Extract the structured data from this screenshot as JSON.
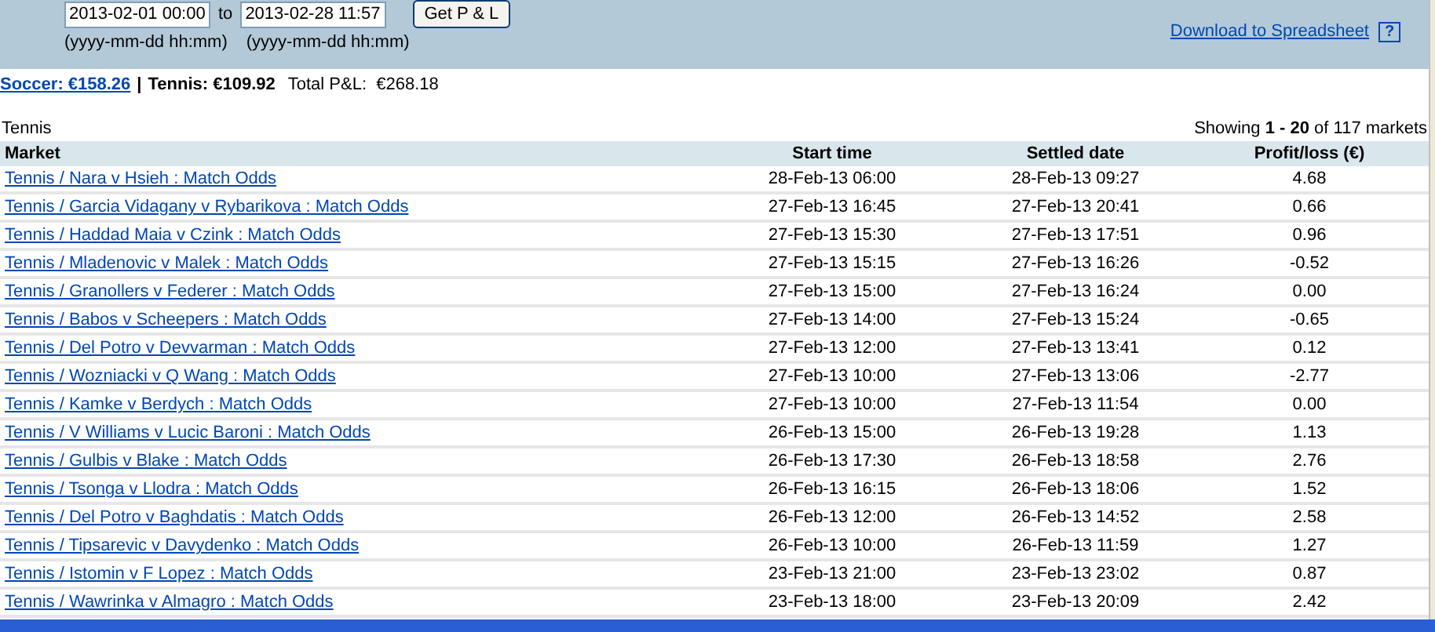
{
  "filter": {
    "from_value": "2013-02-01 00:00",
    "to_label": "to",
    "to_value": "2013-02-28 11:57",
    "button": "Get P & L",
    "from_hint": "(yyyy-mm-dd hh:mm)",
    "to_hint": "(yyyy-mm-dd hh:mm)",
    "download_link": "Download to Spreadsheet",
    "help": "?"
  },
  "summary": {
    "soccer": "Soccer: €158.26",
    "separator": "|",
    "tennis": "Tennis: €109.92",
    "total": "Total P&L:  €268.18"
  },
  "section": "Tennis",
  "showing": "Showing **1 - 20** of 117 markets",
  "table": {
    "columns": [
      "Market",
      "Start time",
      "Settled date",
      "Profit/loss (€)"
    ],
    "rows": [
      [
        "Tennis / Nara v Hsieh : Match Odds",
        "28-Feb-13 06:00",
        "28-Feb-13 09:27",
        "4.68"
      ],
      [
        "Tennis / Garcia Vidagany v Rybarikova : Match Odds",
        "27-Feb-13 16:45",
        "27-Feb-13 20:41",
        "0.66"
      ],
      [
        "Tennis / Haddad Maia v Czink : Match Odds",
        "27-Feb-13 15:30",
        "27-Feb-13 17:51",
        "0.96"
      ],
      [
        "Tennis / Mladenovic v Malek : Match Odds",
        "27-Feb-13 15:15",
        "27-Feb-13 16:26",
        "-0.52"
      ],
      [
        "Tennis / Granollers v Federer : Match Odds",
        "27-Feb-13 15:00",
        "27-Feb-13 16:24",
        "0.00"
      ],
      [
        "Tennis / Babos v Scheepers : Match Odds",
        "27-Feb-13 14:00",
        "27-Feb-13 15:24",
        "-0.65"
      ],
      [
        "Tennis / Del Potro v Devvarman : Match Odds",
        "27-Feb-13 12:00",
        "27-Feb-13 13:41",
        "0.12"
      ],
      [
        "Tennis / Wozniacki v Q Wang : Match Odds",
        "27-Feb-13 10:00",
        "27-Feb-13 13:06",
        "-2.77"
      ],
      [
        "Tennis / Kamke v Berdych : Match Odds",
        "27-Feb-13 10:00",
        "27-Feb-13 11:54",
        "0.00"
      ],
      [
        "Tennis / V Williams v Lucic Baroni : Match Odds",
        "26-Feb-13 15:00",
        "26-Feb-13 19:28",
        "1.13"
      ],
      [
        "Tennis / Gulbis v Blake : Match Odds",
        "26-Feb-13 17:30",
        "26-Feb-13 18:58",
        "2.76"
      ],
      [
        "Tennis / Tsonga v Llodra : Match Odds",
        "26-Feb-13 16:15",
        "26-Feb-13 18:06",
        "1.52"
      ],
      [
        "Tennis / Del Potro v Baghdatis : Match Odds",
        "26-Feb-13 12:00",
        "26-Feb-13 14:52",
        "2.58"
      ],
      [
        "Tennis / Tipsarevic v Davydenko : Match Odds",
        "26-Feb-13 10:00",
        "26-Feb-13 11:59",
        "1.27"
      ],
      [
        "Tennis / Istomin v F Lopez : Match Odds",
        "23-Feb-13 21:00",
        "23-Feb-13 23:02",
        "0.87"
      ],
      [
        "Tennis / Wawrinka v Almagro : Match Odds",
        "23-Feb-13 18:00",
        "23-Feb-13 20:09",
        "2.42"
      ]
    ]
  }
}
